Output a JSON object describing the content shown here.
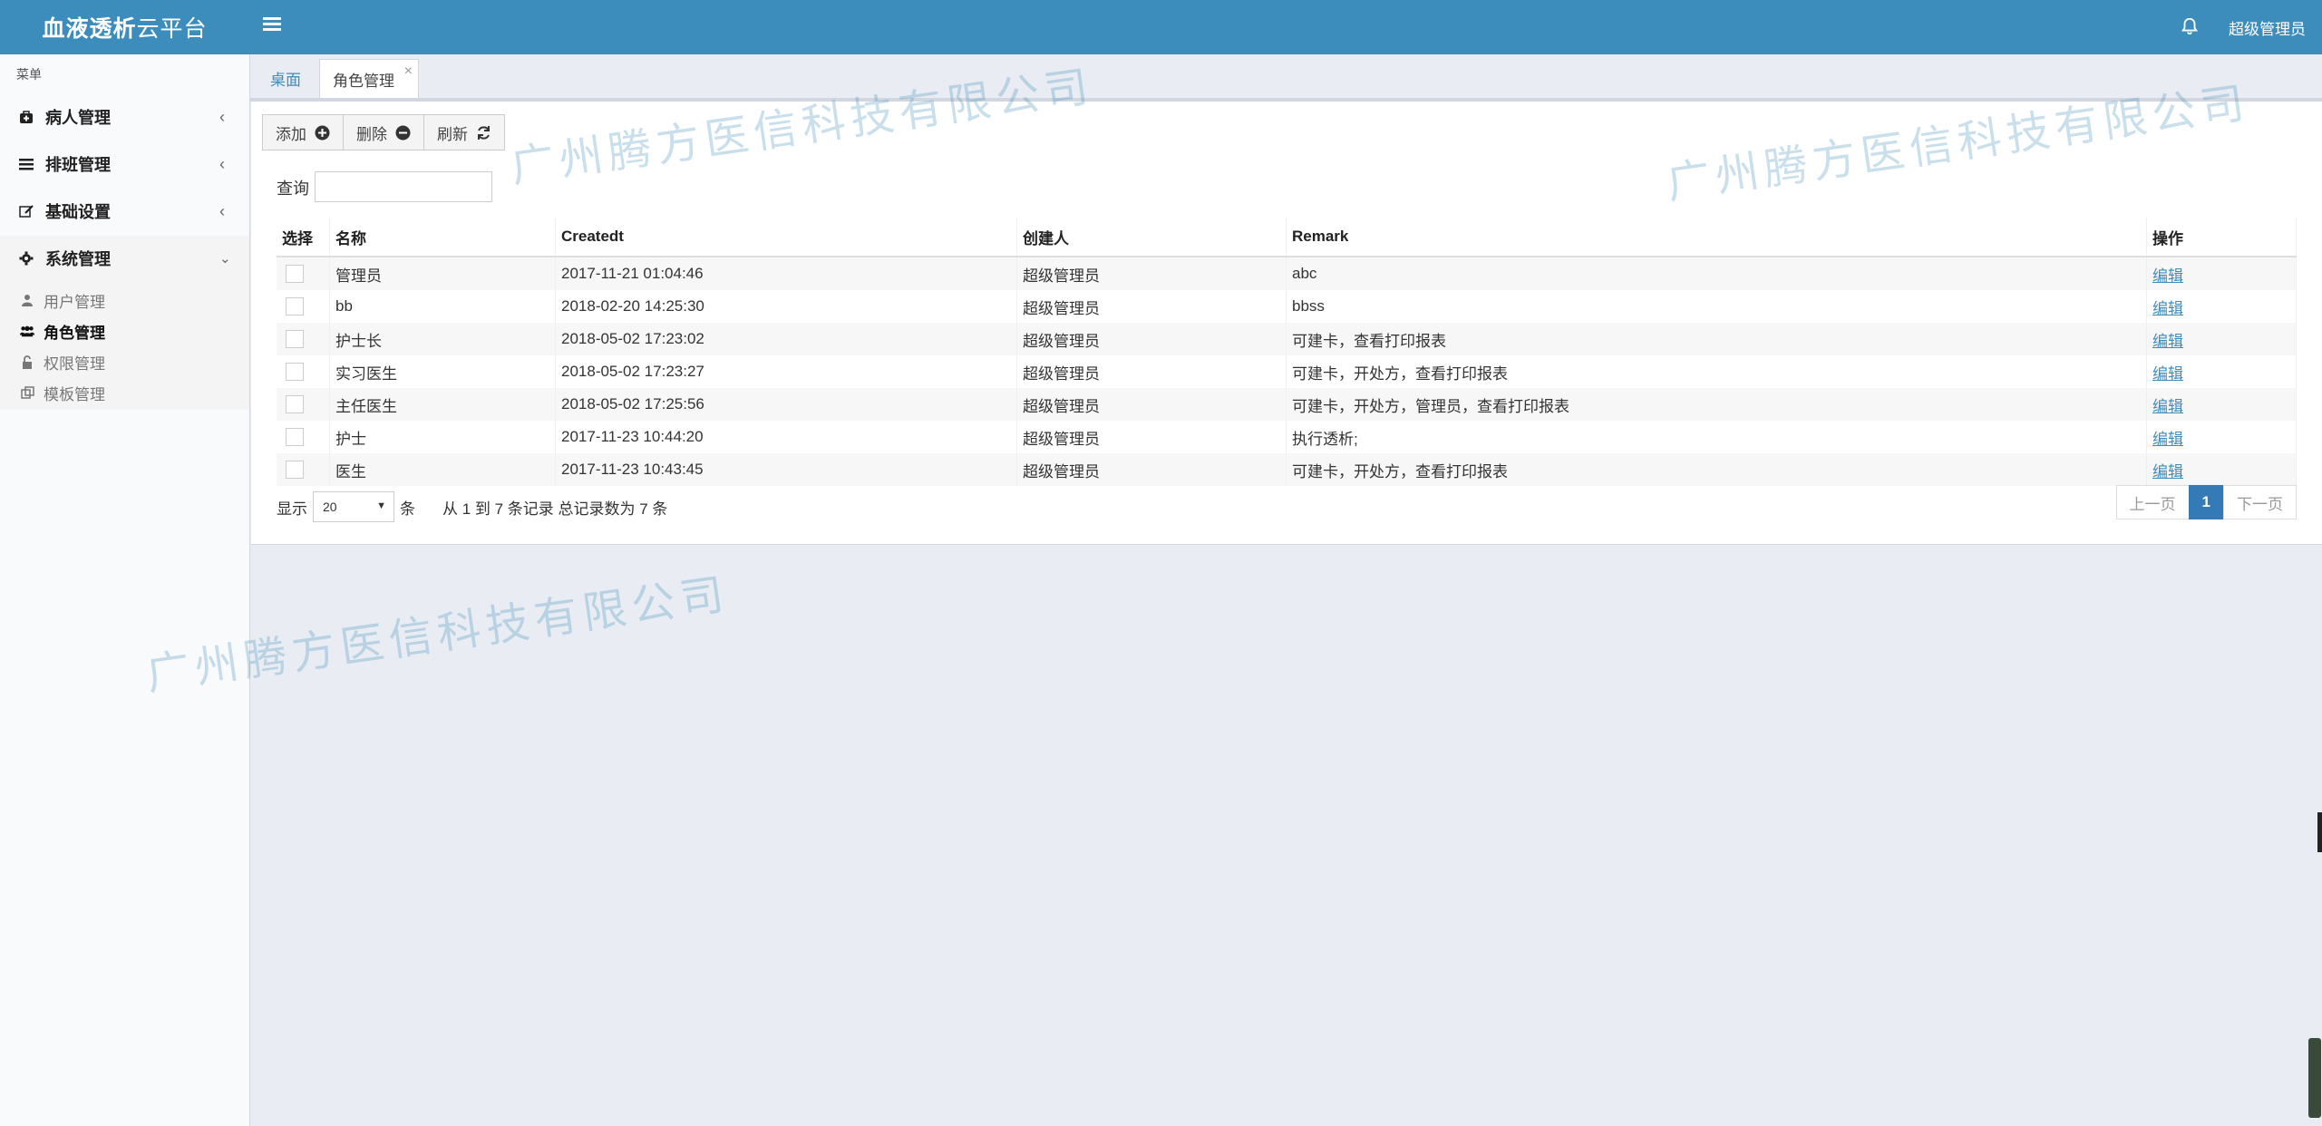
{
  "header": {
    "brand_bold": "血液透析",
    "brand_light": "云平台",
    "username": "超级管理员"
  },
  "sidebar": {
    "menu_label": "菜单",
    "items": [
      {
        "label": "病人管理",
        "icon": "medkit-icon"
      },
      {
        "label": "排班管理",
        "icon": "list-icon"
      },
      {
        "label": "基础设置",
        "icon": "edit-icon"
      },
      {
        "label": "系统管理",
        "icon": "gear-icon"
      }
    ],
    "sub_items": [
      {
        "label": "用户管理",
        "icon": "user-icon"
      },
      {
        "label": "角色管理",
        "icon": "users-icon"
      },
      {
        "label": "权限管理",
        "icon": "unlock-icon"
      },
      {
        "label": "模板管理",
        "icon": "clone-icon"
      }
    ]
  },
  "tabs": {
    "home": "桌面",
    "current": "角色管理",
    "close": "×"
  },
  "toolbar": {
    "add": "添加",
    "delete": "删除",
    "refresh": "刷新"
  },
  "search": {
    "label": "查询",
    "value": "",
    "placeholder": ""
  },
  "table": {
    "headers": [
      "选择",
      "名称",
      "Createdt",
      "创建人",
      "Remark",
      "操作"
    ],
    "rows": [
      {
        "name": "管理员",
        "created": "2017-11-21 01:04:46",
        "creator": "超级管理员",
        "remark": "abc",
        "action": "编辑"
      },
      {
        "name": "bb",
        "created": "2018-02-20 14:25:30",
        "creator": "超级管理员",
        "remark": "bbss",
        "action": "编辑"
      },
      {
        "name": "护士长",
        "created": "2018-05-02 17:23:02",
        "creator": "超级管理员",
        "remark": "可建卡，查看打印报表",
        "action": "编辑"
      },
      {
        "name": "实习医生",
        "created": "2018-05-02 17:23:27",
        "creator": "超级管理员",
        "remark": "可建卡，开处方，查看打印报表",
        "action": "编辑"
      },
      {
        "name": "主任医生",
        "created": "2018-05-02 17:25:56",
        "creator": "超级管理员",
        "remark": "可建卡，开处方，管理员，查看打印报表",
        "action": "编辑"
      },
      {
        "name": "护士",
        "created": "2017-11-23 10:44:20",
        "creator": "超级管理员",
        "remark": "执行透析;",
        "action": "编辑"
      },
      {
        "name": "医生",
        "created": "2017-11-23 10:43:45",
        "creator": "超级管理员",
        "remark": "可建卡，开处方，查看打印报表",
        "action": "编辑"
      }
    ]
  },
  "footer": {
    "show_label": "显示",
    "page_size": "20",
    "unit": "条",
    "info": "从 1 到 7 条记录 总记录数为 7 条"
  },
  "pager": {
    "prev": "上一页",
    "current": "1",
    "next": "下一页"
  },
  "watermark": "广州腾方医信科技有限公司",
  "colors": {
    "header": "#3c8dbc",
    "link": "#3c8dbc",
    "pager_active": "#337ab7"
  }
}
